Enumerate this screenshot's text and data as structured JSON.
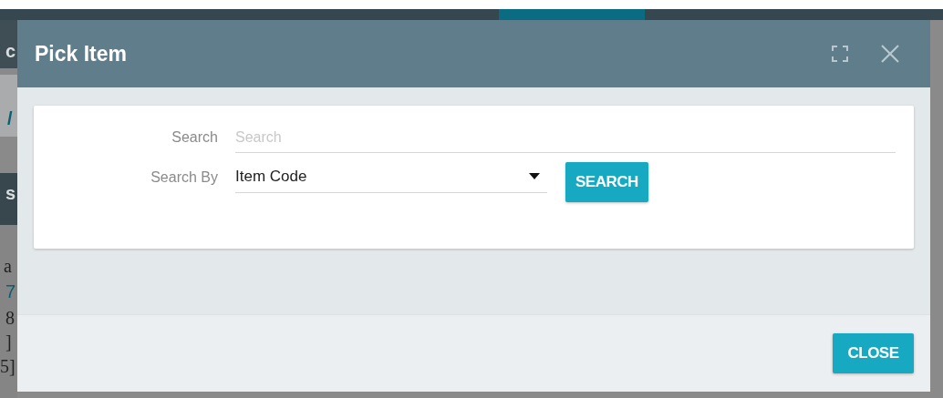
{
  "background": {
    "fragments": [
      {
        "text": "c",
        "kind": "header"
      },
      {
        "text": "/",
        "kind": "link"
      },
      {
        "text": "s",
        "kind": "header"
      },
      {
        "text": "a",
        "kind": "body"
      },
      {
        "text": "7",
        "kind": "link"
      },
      {
        "text": "8",
        "kind": "body"
      },
      {
        "text": "]",
        "kind": "body"
      },
      {
        "text": "5]",
        "kind": "body"
      }
    ]
  },
  "dialog": {
    "title": "Pick Item",
    "fields": [
      {
        "label": "Search",
        "kind": "text",
        "placeholder": "Search"
      },
      {
        "label": "Search By",
        "kind": "select",
        "value": "Item Code"
      }
    ],
    "search_button": "SEARCH",
    "close_button": "CLOSE"
  }
}
